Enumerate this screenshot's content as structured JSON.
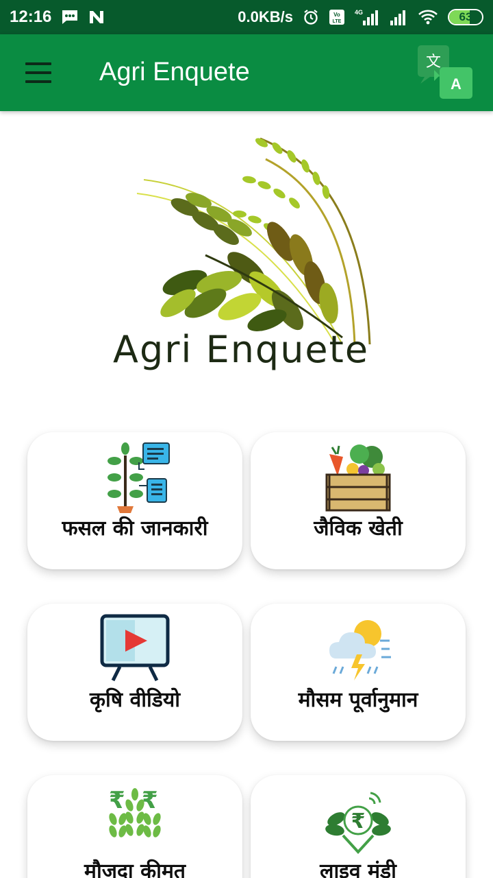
{
  "status_bar": {
    "time": "12:16",
    "net_speed": "0.0KB/s",
    "battery": "63",
    "battery_level": 0.63,
    "icons": [
      "message-icon",
      "n-icon",
      "alarm-icon",
      "volte-icon",
      "signal-4g-icon",
      "signal-icon",
      "wifi-icon",
      "battery-icon"
    ]
  },
  "app_bar": {
    "title": "Agri Enquete",
    "menu_icon": "hamburger-menu-icon",
    "translate_icon": "translate-icon"
  },
  "logo": {
    "text": "Agri Enquete"
  },
  "colors": {
    "status_bar": "#075a2c",
    "app_bar": "#0a8c42",
    "accent_green": "#7cb342"
  },
  "menu": [
    {
      "label": "फसल की जानकारी",
      "icon": "crop-info-icon"
    },
    {
      "label": "जैविक खेती",
      "icon": "vegetable-crate-icon"
    },
    {
      "label": "कृषि वीडियो",
      "icon": "video-player-icon"
    },
    {
      "label": "मौसम पूर्वानुमान",
      "icon": "weather-icon"
    },
    {
      "label": "मौजदा कीमत",
      "icon": "price-crop-icon"
    },
    {
      "label": "लाइव मंडी",
      "icon": "live-market-icon"
    }
  ]
}
